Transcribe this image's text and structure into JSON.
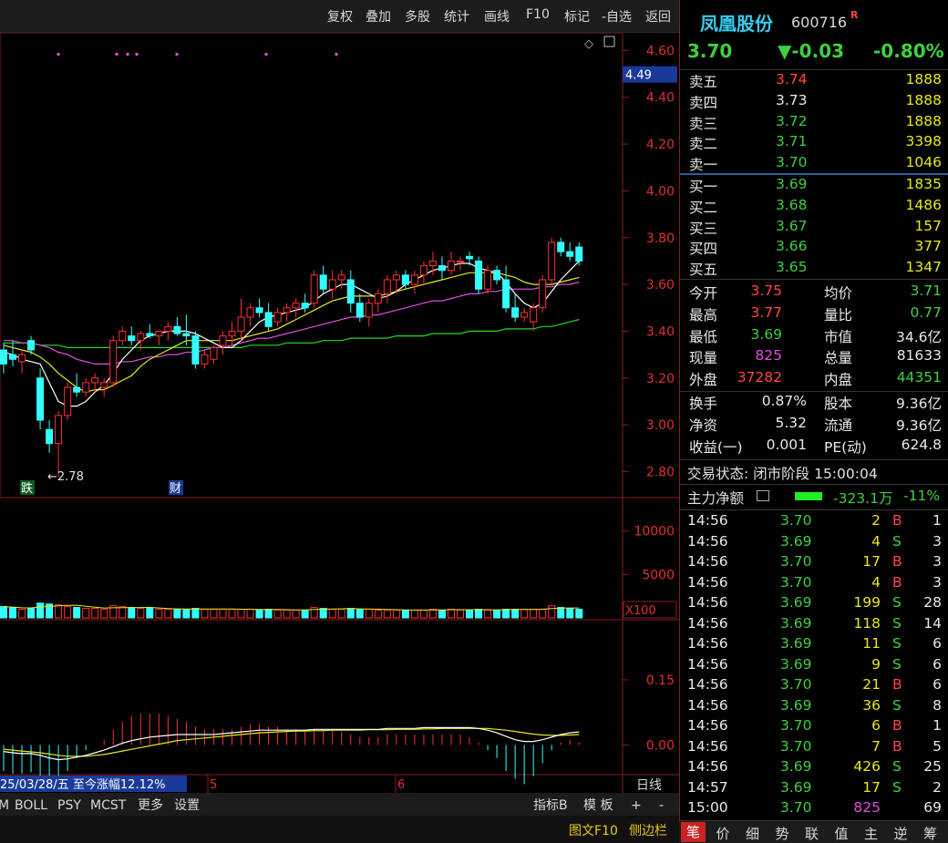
{
  "toolbar": {
    "items": [
      "复权",
      "叠加",
      "多股",
      "统计",
      "画线",
      "F10",
      "标记",
      "-自选",
      "返回"
    ]
  },
  "stock": {
    "name": "凤凰股份",
    "code": "600716",
    "badge": "R",
    "price": "3.70",
    "change": "▼-0.03",
    "change_pct": "-0.80%"
  },
  "chart": {
    "price_ticks": [
      "4.60",
      "4.40",
      "4.20",
      "4.00",
      "3.80",
      "3.60",
      "3.40",
      "3.20",
      "3.00",
      "2.80"
    ],
    "price_marker": "4.49",
    "low_label": "←2.78",
    "event_labels": {
      "die": "跌",
      "cai": "财"
    },
    "vol_ticks": [
      "10000",
      "5000"
    ],
    "vol_unit": "X100",
    "macd_ticks": [
      "0.15",
      "0.00"
    ],
    "date_bar": {
      "date": "25/03/28/五",
      "range": "至今涨幅12.12%",
      "m5": "5",
      "m6": "6",
      "period": "日线"
    },
    "indicator_tabs": [
      "M",
      "BOLL",
      "PSY",
      "MCST",
      "更多",
      "设置"
    ],
    "right_tools": [
      "指标B",
      "模 板",
      "+",
      "-"
    ],
    "bottom_links": [
      "图文F10",
      "侧边栏"
    ]
  },
  "chart_data": {
    "type": "candlestick",
    "ylim": [
      2.72,
      4.66
    ],
    "ohlc": [
      [
        3.32,
        3.35,
        3.22,
        3.26
      ],
      [
        3.3,
        3.36,
        3.25,
        3.28
      ],
      [
        3.27,
        3.32,
        3.22,
        3.3
      ],
      [
        3.36,
        3.38,
        3.3,
        3.32
      ],
      [
        3.2,
        3.24,
        2.98,
        3.02
      ],
      [
        2.98,
        3.02,
        2.88,
        2.92
      ],
      [
        2.92,
        3.06,
        2.78,
        3.04
      ],
      [
        3.04,
        3.18,
        3.02,
        3.16
      ],
      [
        3.16,
        3.22,
        3.12,
        3.14
      ],
      [
        3.14,
        3.2,
        3.12,
        3.18
      ],
      [
        3.18,
        3.22,
        3.14,
        3.2
      ],
      [
        3.16,
        3.2,
        3.12,
        3.18
      ],
      [
        3.18,
        3.38,
        3.16,
        3.36
      ],
      [
        3.36,
        3.42,
        3.34,
        3.4
      ],
      [
        3.38,
        3.42,
        3.34,
        3.36
      ],
      [
        3.36,
        3.4,
        3.32,
        3.39
      ],
      [
        3.39,
        3.43,
        3.37,
        3.38
      ],
      [
        3.38,
        3.4,
        3.34,
        3.4
      ],
      [
        3.4,
        3.44,
        3.36,
        3.42
      ],
      [
        3.42,
        3.46,
        3.38,
        3.39
      ],
      [
        3.39,
        3.47,
        3.34,
        3.38
      ],
      [
        3.38,
        3.4,
        3.24,
        3.26
      ],
      [
        3.26,
        3.32,
        3.24,
        3.3
      ],
      [
        3.28,
        3.34,
        3.26,
        3.33
      ],
      [
        3.34,
        3.4,
        3.3,
        3.38
      ],
      [
        3.38,
        3.44,
        3.34,
        3.4
      ],
      [
        3.4,
        3.54,
        3.36,
        3.46
      ],
      [
        3.46,
        3.52,
        3.42,
        3.5
      ],
      [
        3.5,
        3.54,
        3.46,
        3.48
      ],
      [
        3.48,
        3.52,
        3.4,
        3.42
      ],
      [
        3.44,
        3.5,
        3.42,
        3.48
      ],
      [
        3.48,
        3.52,
        3.44,
        3.5
      ],
      [
        3.5,
        3.54,
        3.46,
        3.52
      ],
      [
        3.52,
        3.56,
        3.48,
        3.5
      ],
      [
        3.52,
        3.66,
        3.5,
        3.64
      ],
      [
        3.64,
        3.68,
        3.56,
        3.58
      ],
      [
        3.58,
        3.66,
        3.54,
        3.62
      ],
      [
        3.62,
        3.66,
        3.58,
        3.64
      ],
      [
        3.62,
        3.66,
        3.48,
        3.52
      ],
      [
        3.52,
        3.56,
        3.44,
        3.46
      ],
      [
        3.46,
        3.54,
        3.42,
        3.52
      ],
      [
        3.52,
        3.58,
        3.48,
        3.56
      ],
      [
        3.56,
        3.64,
        3.52,
        3.62
      ],
      [
        3.62,
        3.66,
        3.56,
        3.64
      ],
      [
        3.64,
        3.66,
        3.58,
        3.6
      ],
      [
        3.6,
        3.66,
        3.56,
        3.64
      ],
      [
        3.64,
        3.7,
        3.6,
        3.68
      ],
      [
        3.68,
        3.74,
        3.64,
        3.7
      ],
      [
        3.68,
        3.72,
        3.62,
        3.66
      ],
      [
        3.66,
        3.74,
        3.64,
        3.7
      ],
      [
        3.7,
        3.72,
        3.66,
        3.7
      ],
      [
        3.72,
        3.74,
        3.68,
        3.71
      ],
      [
        3.7,
        3.72,
        3.56,
        3.58
      ],
      [
        3.58,
        3.68,
        3.56,
        3.66
      ],
      [
        3.66,
        3.68,
        3.6,
        3.62
      ],
      [
        3.62,
        3.68,
        3.48,
        3.5
      ],
      [
        3.5,
        3.56,
        3.44,
        3.46
      ],
      [
        3.46,
        3.5,
        3.44,
        3.48
      ],
      [
        3.44,
        3.52,
        3.4,
        3.5
      ],
      [
        3.5,
        3.64,
        3.48,
        3.62
      ],
      [
        3.62,
        3.8,
        3.6,
        3.78
      ],
      [
        3.78,
        3.8,
        3.72,
        3.74
      ],
      [
        3.74,
        3.78,
        3.7,
        3.72
      ],
      [
        3.76,
        3.78,
        3.68,
        3.7
      ]
    ],
    "ma5": [
      3.31,
      3.3,
      3.28,
      3.27,
      3.26,
      3.18,
      3.1,
      3.08,
      3.08,
      3.1,
      3.14,
      3.17,
      3.22,
      3.28,
      3.32,
      3.36,
      3.38,
      3.39,
      3.4,
      3.4,
      3.4,
      3.39,
      3.37,
      3.35,
      3.33,
      3.33,
      3.36,
      3.4,
      3.44,
      3.46,
      3.47,
      3.48,
      3.49,
      3.5,
      3.53,
      3.56,
      3.58,
      3.6,
      3.6,
      3.58,
      3.56,
      3.54,
      3.55,
      3.57,
      3.6,
      3.62,
      3.64,
      3.66,
      3.67,
      3.68,
      3.69,
      3.69,
      3.67,
      3.66,
      3.65,
      3.61,
      3.56,
      3.52,
      3.5,
      3.52,
      3.57,
      3.62,
      3.66,
      3.7
    ],
    "ma10": [
      3.34,
      3.33,
      3.32,
      3.31,
      3.29,
      3.26,
      3.22,
      3.19,
      3.16,
      3.14,
      3.15,
      3.15,
      3.17,
      3.19,
      3.21,
      3.25,
      3.28,
      3.3,
      3.32,
      3.34,
      3.36,
      3.36,
      3.36,
      3.36,
      3.36,
      3.36,
      3.37,
      3.38,
      3.39,
      3.4,
      3.41,
      3.43,
      3.45,
      3.47,
      3.49,
      3.51,
      3.53,
      3.54,
      3.55,
      3.55,
      3.55,
      3.55,
      3.56,
      3.57,
      3.58,
      3.59,
      3.6,
      3.61,
      3.62,
      3.63,
      3.64,
      3.65,
      3.65,
      3.65,
      3.65,
      3.64,
      3.63,
      3.61,
      3.6,
      3.6,
      3.6,
      3.61,
      3.62,
      3.63
    ],
    "ma20": [
      3.36,
      3.36,
      3.35,
      3.35,
      3.34,
      3.33,
      3.31,
      3.3,
      3.28,
      3.27,
      3.26,
      3.26,
      3.26,
      3.27,
      3.27,
      3.28,
      3.29,
      3.29,
      3.3,
      3.3,
      3.31,
      3.31,
      3.32,
      3.33,
      3.33,
      3.34,
      3.35,
      3.36,
      3.37,
      3.37,
      3.38,
      3.39,
      3.4,
      3.41,
      3.42,
      3.43,
      3.44,
      3.45,
      3.46,
      3.46,
      3.47,
      3.47,
      3.48,
      3.49,
      3.5,
      3.51,
      3.52,
      3.53,
      3.53,
      3.54,
      3.55,
      3.56,
      3.56,
      3.57,
      3.57,
      3.58,
      3.58,
      3.58,
      3.58,
      3.59,
      3.59,
      3.6,
      3.6,
      3.61
    ],
    "ma60": [
      3.35,
      3.35,
      3.35,
      3.35,
      3.34,
      3.34,
      3.34,
      3.33,
      3.33,
      3.33,
      3.33,
      3.33,
      3.33,
      3.33,
      3.33,
      3.33,
      3.33,
      3.33,
      3.33,
      3.33,
      3.33,
      3.33,
      3.33,
      3.33,
      3.33,
      3.33,
      3.33,
      3.34,
      3.34,
      3.34,
      3.34,
      3.35,
      3.35,
      3.35,
      3.35,
      3.36,
      3.36,
      3.36,
      3.37,
      3.37,
      3.37,
      3.37,
      3.37,
      3.38,
      3.38,
      3.38,
      3.38,
      3.39,
      3.39,
      3.39,
      3.39,
      3.4,
      3.4,
      3.4,
      3.4,
      3.41,
      3.41,
      3.41,
      3.41,
      3.42,
      3.42,
      3.43,
      3.44,
      3.45
    ],
    "volumes": [
      1300,
      1200,
      1000,
      1100,
      1700,
      1600,
      1500,
      1300,
      1200,
      1100,
      1100,
      1000,
      1400,
      1300,
      1200,
      1100,
      1100,
      1000,
      1000,
      1000,
      1000,
      1100,
      1000,
      1000,
      1000,
      1000,
      1000,
      1000,
      900,
      1000,
      900,
      900,
      900,
      900,
      1200,
      1100,
      1000,
      1000,
      1100,
      1000,
      1000,
      900,
      900,
      900,
      900,
      900,
      900,
      1000,
      900,
      1000,
      900,
      900,
      1000,
      900,
      900,
      1000,
      1000,
      1000,
      1000,
      1000,
      1400,
      1200,
      1100,
      1000
    ],
    "vol_ylim": [
      0,
      13000
    ],
    "macd_hist": [
      -0.02,
      -0.022,
      -0.022,
      -0.021,
      -0.03,
      -0.034,
      -0.03,
      -0.02,
      -0.01,
      -0.004,
      0.0,
      0.004,
      0.012,
      0.018,
      0.022,
      0.024,
      0.024,
      0.024,
      0.022,
      0.02,
      0.018,
      0.014,
      0.012,
      0.012,
      0.012,
      0.012,
      0.014,
      0.016,
      0.016,
      0.014,
      0.014,
      0.012,
      0.012,
      0.01,
      0.012,
      0.012,
      0.012,
      0.01,
      0.008,
      0.006,
      0.006,
      0.006,
      0.008,
      0.008,
      0.008,
      0.008,
      0.008,
      0.008,
      0.008,
      0.008,
      0.008,
      0.006,
      0.002,
      -0.004,
      -0.01,
      -0.02,
      -0.026,
      -0.03,
      -0.024,
      -0.014,
      -0.004,
      0.002,
      0.004,
      0.002
    ],
    "dif": [
      -0.015,
      -0.018,
      -0.02,
      -0.02,
      -0.024,
      -0.03,
      -0.034,
      -0.032,
      -0.028,
      -0.024,
      -0.018,
      -0.012,
      -0.004,
      0.004,
      0.01,
      0.014,
      0.018,
      0.02,
      0.022,
      0.024,
      0.024,
      0.024,
      0.024,
      0.024,
      0.026,
      0.028,
      0.03,
      0.032,
      0.034,
      0.034,
      0.034,
      0.034,
      0.034,
      0.034,
      0.036,
      0.036,
      0.036,
      0.036,
      0.036,
      0.036,
      0.036,
      0.036,
      0.038,
      0.038,
      0.038,
      0.038,
      0.04,
      0.04,
      0.04,
      0.04,
      0.04,
      0.04,
      0.038,
      0.034,
      0.028,
      0.02,
      0.012,
      0.008,
      0.008,
      0.012,
      0.018,
      0.024,
      0.028,
      0.03
    ],
    "dea": [
      -0.01,
      -0.012,
      -0.014,
      -0.016,
      -0.018,
      -0.021,
      -0.024,
      -0.026,
      -0.026,
      -0.026,
      -0.024,
      -0.022,
      -0.018,
      -0.014,
      -0.01,
      -0.006,
      -0.002,
      0.002,
      0.006,
      0.01,
      0.012,
      0.014,
      0.016,
      0.018,
      0.02,
      0.022,
      0.024,
      0.026,
      0.028,
      0.029,
      0.03,
      0.031,
      0.032,
      0.032,
      0.033,
      0.033,
      0.034,
      0.034,
      0.034,
      0.034,
      0.035,
      0.035,
      0.035,
      0.036,
      0.036,
      0.036,
      0.037,
      0.037,
      0.038,
      0.038,
      0.038,
      0.038,
      0.038,
      0.038,
      0.036,
      0.034,
      0.031,
      0.028,
      0.025,
      0.023,
      0.022,
      0.022,
      0.023,
      0.024
    ],
    "macd_ylim": [
      -0.06,
      0.28
    ],
    "ma_colors": {
      "ma5": "#ffffff",
      "ma10": "#e8e81a",
      "ma20": "#e050e0",
      "ma60": "#22dd22"
    },
    "candle_colors": {
      "up": "#ff3030",
      "down": "#33ffff"
    }
  },
  "orderbook": {
    "asks": [
      {
        "label": "卖五",
        "price": "3.74",
        "vol": "1888"
      },
      {
        "label": "卖四",
        "price": "3.73",
        "vol": "1888"
      },
      {
        "label": "卖三",
        "price": "3.72",
        "vol": "1888"
      },
      {
        "label": "卖二",
        "price": "3.71",
        "vol": "3398"
      },
      {
        "label": "卖一",
        "price": "3.70",
        "vol": "1046"
      }
    ],
    "bids": [
      {
        "label": "买一",
        "price": "3.69",
        "vol": "1835"
      },
      {
        "label": "买二",
        "price": "3.68",
        "vol": "1486"
      },
      {
        "label": "买三",
        "price": "3.67",
        "vol": "157"
      },
      {
        "label": "买四",
        "price": "3.66",
        "vol": "377"
      },
      {
        "label": "买五",
        "price": "3.65",
        "vol": "1347"
      }
    ]
  },
  "quote": {
    "rows": [
      {
        "l1": "今开",
        "v1": "3.75",
        "l2": "均价",
        "v2": "3.71"
      },
      {
        "l1": "最高",
        "v1": "3.77",
        "l2": "量比",
        "v2": "0.77"
      },
      {
        "l1": "最低",
        "v1": "3.69",
        "l2": "市值",
        "v2": "34.6亿"
      },
      {
        "l1": "现量",
        "v1": "825",
        "l2": "总量",
        "v2": "81633"
      },
      {
        "l1": "外盘",
        "v1": "37282",
        "l2": "内盘",
        "v2": "44351"
      }
    ],
    "rows2": [
      {
        "l1": "换手",
        "v1": "0.87%",
        "l2": "股本",
        "v2": "9.36亿"
      },
      {
        "l1": "净资",
        "v1": "5.32",
        "l2": "流通",
        "v2": "9.36亿"
      },
      {
        "l1": "收益(一)",
        "v1": "0.001",
        "l2": "PE(动)",
        "v2": "624.8"
      }
    ],
    "status": "交易状态: 闭市阶段 15:00:04",
    "mainforce_label": "主力净额",
    "mainforce_value": "-323.1万",
    "mainforce_pct": "-11%"
  },
  "ticks": [
    {
      "t": "14:56",
      "p": "3.70",
      "v": "2",
      "s": "B",
      "n": "1"
    },
    {
      "t": "14:56",
      "p": "3.69",
      "v": "4",
      "s": "S",
      "n": "3"
    },
    {
      "t": "14:56",
      "p": "3.70",
      "v": "17",
      "s": "B",
      "n": "3"
    },
    {
      "t": "14:56",
      "p": "3.70",
      "v": "4",
      "s": "B",
      "n": "3"
    },
    {
      "t": "14:56",
      "p": "3.69",
      "v": "199",
      "s": "S",
      "n": "28"
    },
    {
      "t": "14:56",
      "p": "3.69",
      "v": "118",
      "s": "S",
      "n": "14"
    },
    {
      "t": "14:56",
      "p": "3.69",
      "v": "11",
      "s": "S",
      "n": "6"
    },
    {
      "t": "14:56",
      "p": "3.69",
      "v": "9",
      "s": "S",
      "n": "6"
    },
    {
      "t": "14:56",
      "p": "3.70",
      "v": "21",
      "s": "B",
      "n": "6"
    },
    {
      "t": "14:56",
      "p": "3.69",
      "v": "36",
      "s": "S",
      "n": "8"
    },
    {
      "t": "14:56",
      "p": "3.70",
      "v": "6",
      "s": "B",
      "n": "1"
    },
    {
      "t": "14:56",
      "p": "3.70",
      "v": "7",
      "s": "B",
      "n": "5"
    },
    {
      "t": "14:56",
      "p": "3.69",
      "v": "426",
      "s": "S",
      "n": "25"
    },
    {
      "t": "14:57",
      "p": "3.69",
      "v": "17",
      "s": "S",
      "n": "2"
    },
    {
      "t": "15:00",
      "p": "3.70",
      "v": "825",
      "s": "",
      "n": "69"
    }
  ],
  "bottom_tabs": [
    "笔",
    "价",
    "细",
    "势",
    "联",
    "值",
    "主",
    "逆",
    "筹"
  ]
}
